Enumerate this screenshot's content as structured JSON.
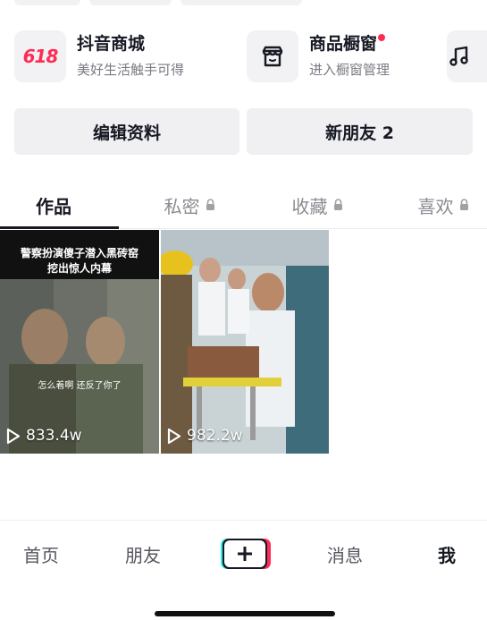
{
  "services": [
    {
      "badge": "618",
      "title": "抖音商城",
      "subtitle": "美好生活触手可得",
      "icon": "shop-618-icon",
      "has_dot": false
    },
    {
      "title": "商品橱窗",
      "subtitle": "进入橱窗管理",
      "icon": "storefront-icon",
      "has_dot": true
    },
    {
      "icon": "music-note-icon"
    }
  ],
  "profile_buttons": {
    "edit_label": "编辑资料",
    "friends_label": "新朋友 2"
  },
  "tabs": [
    {
      "label": "作品",
      "active": true,
      "locked": false
    },
    {
      "label": "私密",
      "active": false,
      "locked": true
    },
    {
      "label": "收藏",
      "active": false,
      "locked": true
    },
    {
      "label": "喜欢",
      "active": false,
      "locked": true
    }
  ],
  "videos": [
    {
      "caption_line1": "警察扮演傻子潜入黑砖窑",
      "caption_line2": "挖出惊人内幕",
      "subtitle": "怎么着啊 还反了你了",
      "views": "833.4w"
    },
    {
      "views": "982.2w"
    }
  ],
  "bottom_nav": {
    "home": "首页",
    "friends": "朋友",
    "messages": "消息",
    "me": "我"
  },
  "colors": {
    "accent_red": "#fe2c55",
    "accent_cyan": "#25f4ee",
    "text_primary": "#161823",
    "text_secondary": "#7a7b82"
  }
}
